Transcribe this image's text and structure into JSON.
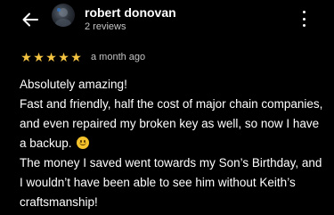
{
  "header": {
    "back_icon": "arrow-left-icon",
    "reviewer_name": "robert donovan",
    "review_count": "2 reviews",
    "more_icon": "more-vertical-icon"
  },
  "review": {
    "rating": 5,
    "max_rating": 5,
    "star_color": "#f5c542",
    "date": "a month ago",
    "text_part1": "Absolutely amazing!\nFast and friendly, half the cost of major chain companies, and even repaired my broken key as well, so now I have a backup.",
    "emoji_icon": "grinning-face-emoji",
    "text_part2": "\nThe money I saved went towards my Son’s Birthday, and I wouldn’t have been able to see him without Keith’s craftsmanship!"
  }
}
